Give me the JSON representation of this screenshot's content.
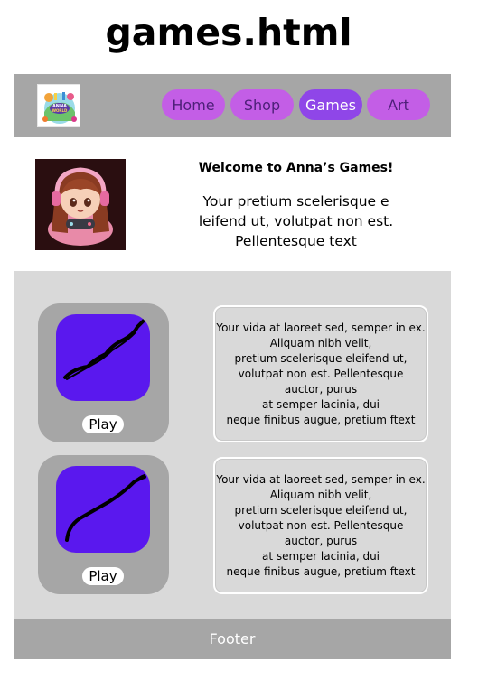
{
  "page": {
    "title": "games.html"
  },
  "header": {
    "logo_text": "ANNA WORLD",
    "nav": [
      {
        "label": "Home",
        "active": false
      },
      {
        "label": "Shop",
        "active": false
      },
      {
        "label": "Games",
        "active": true
      },
      {
        "label": "Art",
        "active": false
      }
    ]
  },
  "welcome": {
    "heading": "Welcome to Anna’s Games!",
    "text": "Your pretium scelerisque e leifend ut, volutpat non est. Pellentesque text"
  },
  "games": [
    {
      "play_label": "Play",
      "description": "Your vida at laoreet sed, semper in ex.\nAliquam nibh velit,\npretium scelerisque eleifend ut,\nvolutpat non est. Pellentesque\nauctor, purus\nat semper lacinia, dui\nneque finibus augue, pretium ftext"
    },
    {
      "play_label": "Play",
      "description": "Your vida at laoreet sed, semper in ex.\nAliquam nibh velit,\npretium scelerisque eleifend ut,\nvolutpat non est. Pellentesque\nauctor, purus\nat semper lacinia, dui\nneque finibus augue, pretium ftext"
    }
  ],
  "footer": {
    "label": "Footer"
  },
  "colors": {
    "nav_button": "#c35ee6",
    "nav_button_active": "#8f46e8",
    "game_thumb": "#5a18ee",
    "panel_gray": "#a6a6a6",
    "section_gray": "#d9d9d9"
  }
}
